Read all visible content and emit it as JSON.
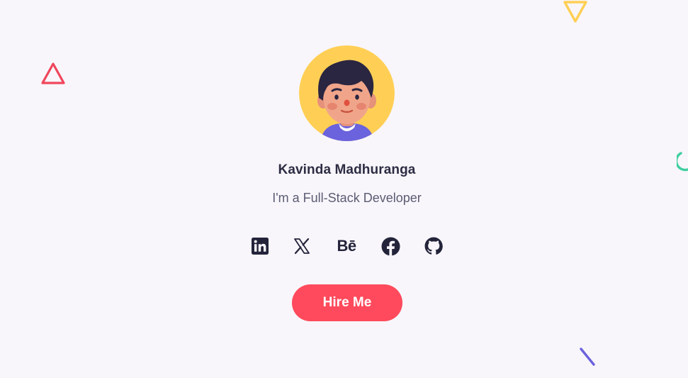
{
  "profile": {
    "name": "Kavinda Madhuranga",
    "tagline": "I'm a Full-Stack Developer",
    "avatar_icon": "developer-avatar-illustration"
  },
  "social": [
    {
      "name": "linkedin",
      "icon": "linkedin-icon",
      "label": ""
    },
    {
      "name": "x",
      "icon": "x-icon",
      "label": ""
    },
    {
      "name": "behance",
      "icon": "behance-icon",
      "label": "Bē"
    },
    {
      "name": "facebook",
      "icon": "facebook-icon",
      "label": ""
    },
    {
      "name": "github",
      "icon": "github-icon",
      "label": ""
    }
  ],
  "cta": {
    "label": "Hire Me",
    "color": "#fe4a5c"
  },
  "theme": {
    "background": "#f8f6fb",
    "text_primary": "#2d2c43",
    "text_secondary": "#5c5b72",
    "icon_color": "#23233a",
    "avatar_bg": "#ffcf55",
    "shape_red": "#f0465c",
    "shape_yellow": "#ffcf55",
    "shape_teal": "#3ecf9f",
    "shape_purple": "#6b62dd"
  }
}
